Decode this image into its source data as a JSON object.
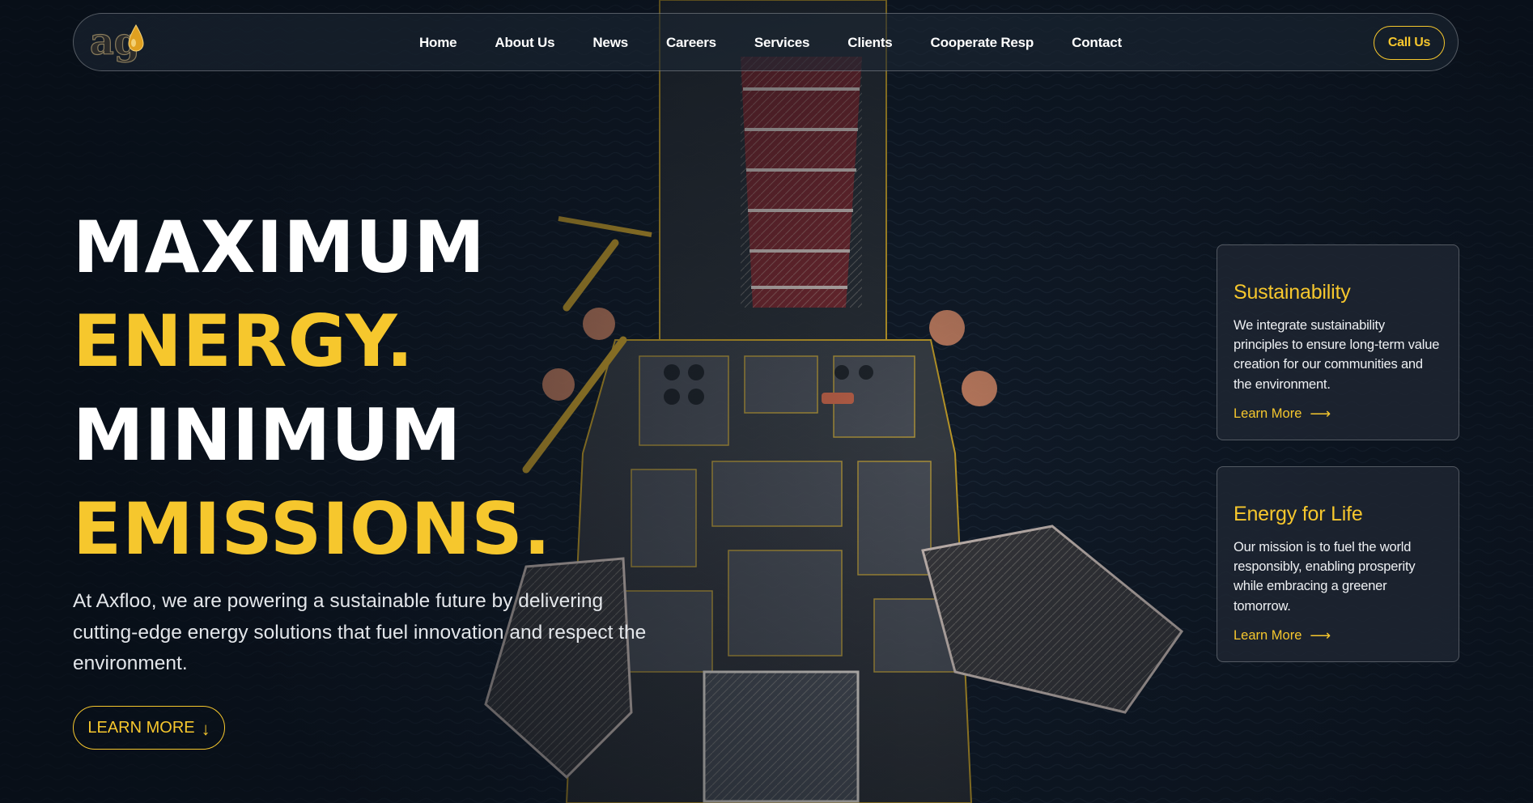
{
  "brand": {
    "logo_text": "ag"
  },
  "nav": {
    "items": [
      {
        "label": "Home"
      },
      {
        "label": "About Us"
      },
      {
        "label": "News"
      },
      {
        "label": "Careers"
      },
      {
        "label": "Services"
      },
      {
        "label": "Clients"
      },
      {
        "label": "Cooperate Resp"
      },
      {
        "label": "Contact"
      }
    ],
    "call_label": "Call Us"
  },
  "hero": {
    "lines": [
      "MAXIMUM",
      "ENERGY.",
      "MINIMUM",
      "EMISSIONS."
    ],
    "description": "At Axfloo, we are powering a sustainable future by delivering cutting-edge energy solutions that fuel innovation and respect the environment.",
    "cta_label": "LEARN MORE",
    "cta_icon": "arrow-down-icon"
  },
  "cards": [
    {
      "title": "Sustainability",
      "text": "We integrate sustainability principles to ensure long-term value creation for our communities and the environment.",
      "link_label": "Learn More",
      "link_icon": "arrow-right-icon"
    },
    {
      "title": "Energy for Life",
      "text": "Our mission is to fuel the world responsibly, enabling prosperity while embracing a greener tomorrow.",
      "link_label": "Learn More",
      "link_icon": "arrow-right-icon"
    }
  ],
  "colors": {
    "accent": "#f6c72d",
    "background": "#0c1420",
    "text": "#ffffff"
  }
}
